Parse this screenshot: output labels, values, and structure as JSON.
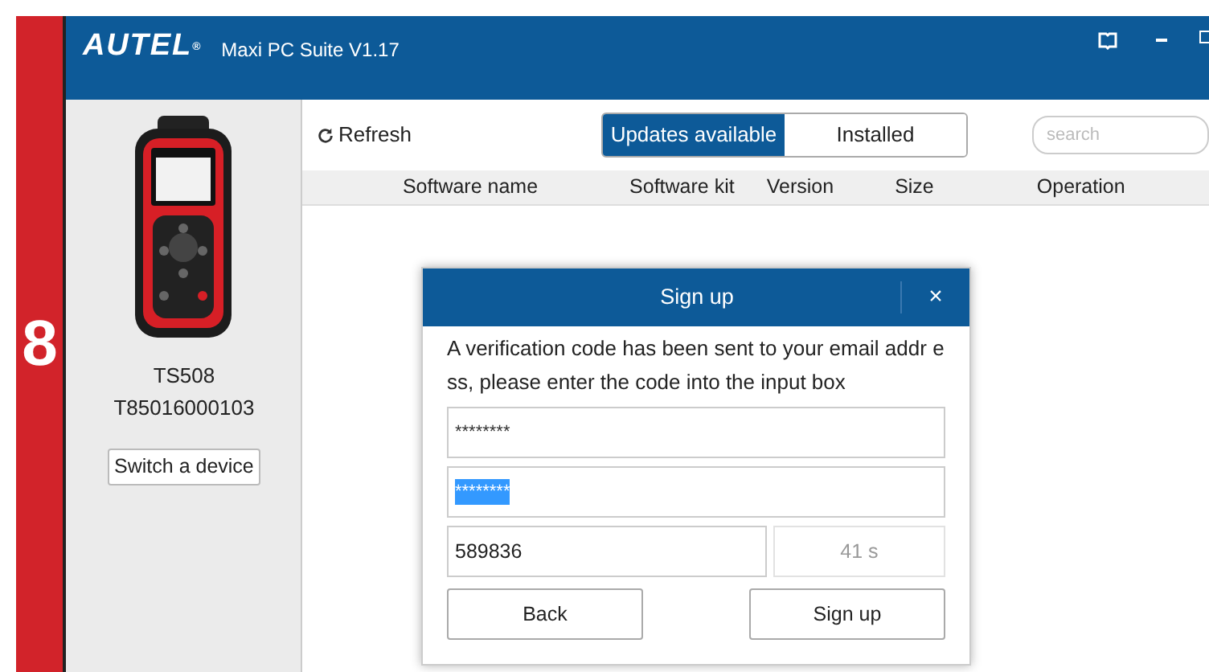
{
  "step_badge": "8",
  "header": {
    "logo": "AUTEL",
    "logo_mark": "®",
    "title": "Maxi PC Suite V1.17"
  },
  "device": {
    "model": "TS508",
    "serial": "T85016000103",
    "switch_button": "Switch a device"
  },
  "toolbar": {
    "refresh": "Refresh",
    "search": {
      "placeholder": "search"
    }
  },
  "tabs": [
    {
      "label": "Updates available",
      "selected": true
    },
    {
      "label": "Installed",
      "selected": false
    }
  ],
  "table": {
    "columns": [
      "Software name",
      "Software kit",
      "Version",
      "Size",
      "Operation"
    ]
  },
  "dialog": {
    "title": "Sign up",
    "close": "×",
    "message": "A verification code has been sent to your email addr ess, please enter the code into the input box",
    "fields": [
      {
        "value": "********",
        "highlighted": false
      },
      {
        "value": "********",
        "highlighted": true
      }
    ],
    "code": {
      "value": "589836"
    },
    "countdown": "41 s",
    "buttons": [
      "Back",
      "Sign up"
    ]
  }
}
